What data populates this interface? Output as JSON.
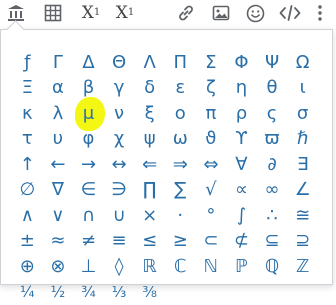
{
  "toolbar": {
    "buttons": [
      {
        "name": "bank-icon",
        "label": ""
      },
      {
        "name": "table-icon",
        "label": ""
      },
      {
        "name": "subscript-button",
        "base": "X",
        "script": "1"
      },
      {
        "name": "superscript-button",
        "base": "X",
        "script": "1"
      },
      {
        "name": "link-icon",
        "label": ""
      },
      {
        "name": "image-icon",
        "label": ""
      },
      {
        "name": "emoji-icon",
        "label": ""
      },
      {
        "name": "code-icon",
        "label": "</>"
      },
      {
        "name": "more-icon",
        "label": "⋮"
      }
    ]
  },
  "symbols": [
    "ƒ",
    "Γ",
    "Δ",
    "Θ",
    "Λ",
    "Π",
    "Σ",
    "Φ",
    "Ψ",
    "Ω",
    "Ξ",
    "α",
    "β",
    "γ",
    "δ",
    "ε",
    "ζ",
    "η",
    "θ",
    "ι",
    "κ",
    "λ",
    "μ",
    "ν",
    "ξ",
    "ο",
    "π",
    "ρ",
    "ς",
    "σ",
    "τ",
    "υ",
    "φ",
    "χ",
    "ψ",
    "ω",
    "ϑ",
    "ϒ",
    "ϖ",
    "ℏ",
    "↑",
    "←",
    "→",
    "↔",
    "⇐",
    "⇒",
    "⇔",
    "∀",
    "∂",
    "∃",
    "∅",
    "∇",
    "∈",
    "∋",
    "∏",
    "∑",
    "√",
    "∝",
    "∞",
    "∠",
    "∧",
    "∨",
    "∩",
    "∪",
    "×",
    "·",
    "°",
    "∫",
    "∴",
    "≅",
    "±",
    "≈",
    "≠",
    "≡",
    "≤",
    "≥",
    "⊂",
    "⊄",
    "⊆",
    "⊇",
    "⊕",
    "⊗",
    "⊥",
    "◊",
    "ℝ",
    "ℂ",
    "ℕ",
    "ℙ",
    "ℚ",
    "ℤ",
    "¼",
    "½",
    "¾",
    "⅓",
    "⅜"
  ],
  "highlighted_symbol": "μ"
}
